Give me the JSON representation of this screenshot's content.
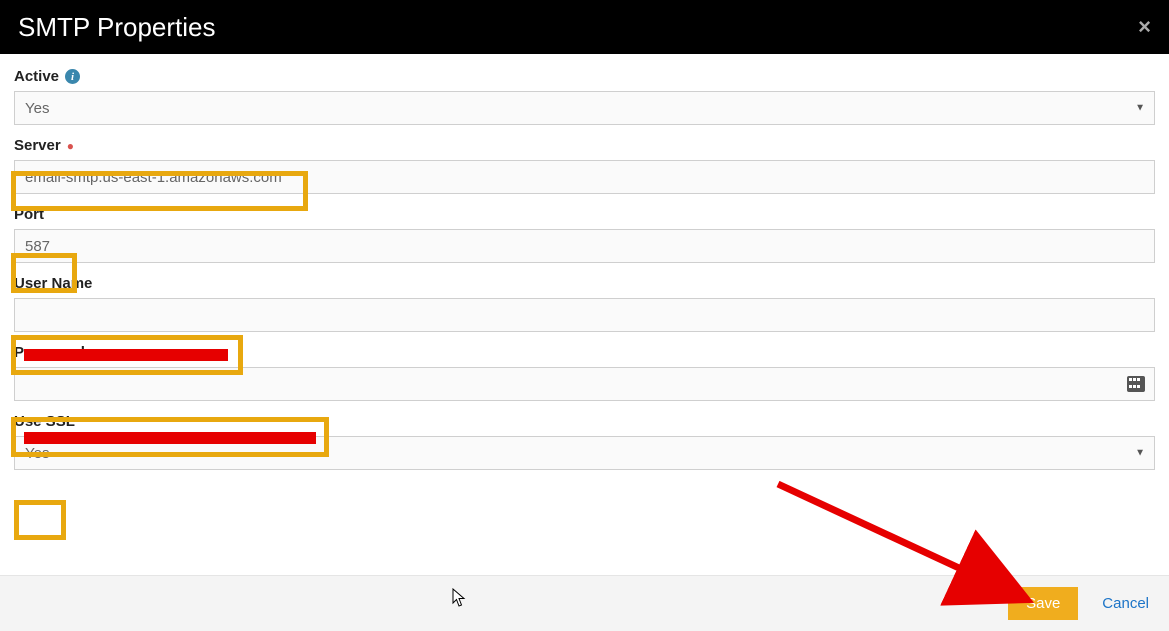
{
  "dialog": {
    "title": "SMTP Properties"
  },
  "fields": {
    "active": {
      "label": "Active",
      "value": "Yes"
    },
    "server": {
      "label": "Server",
      "value": "email-smtp.us-east-1.amazonaws.com"
    },
    "port": {
      "label": "Port",
      "value": "587"
    },
    "username": {
      "label": "User Name",
      "value": ""
    },
    "password": {
      "label": "Password",
      "value": ""
    },
    "usessl": {
      "label": "Use SSL",
      "value": "Yes"
    }
  },
  "footer": {
    "save": "Save",
    "cancel": "Cancel"
  },
  "annotations": {
    "highlight_color": "#e8a80f",
    "redact_color": "#e60000",
    "arrow_color": "#e60000"
  }
}
